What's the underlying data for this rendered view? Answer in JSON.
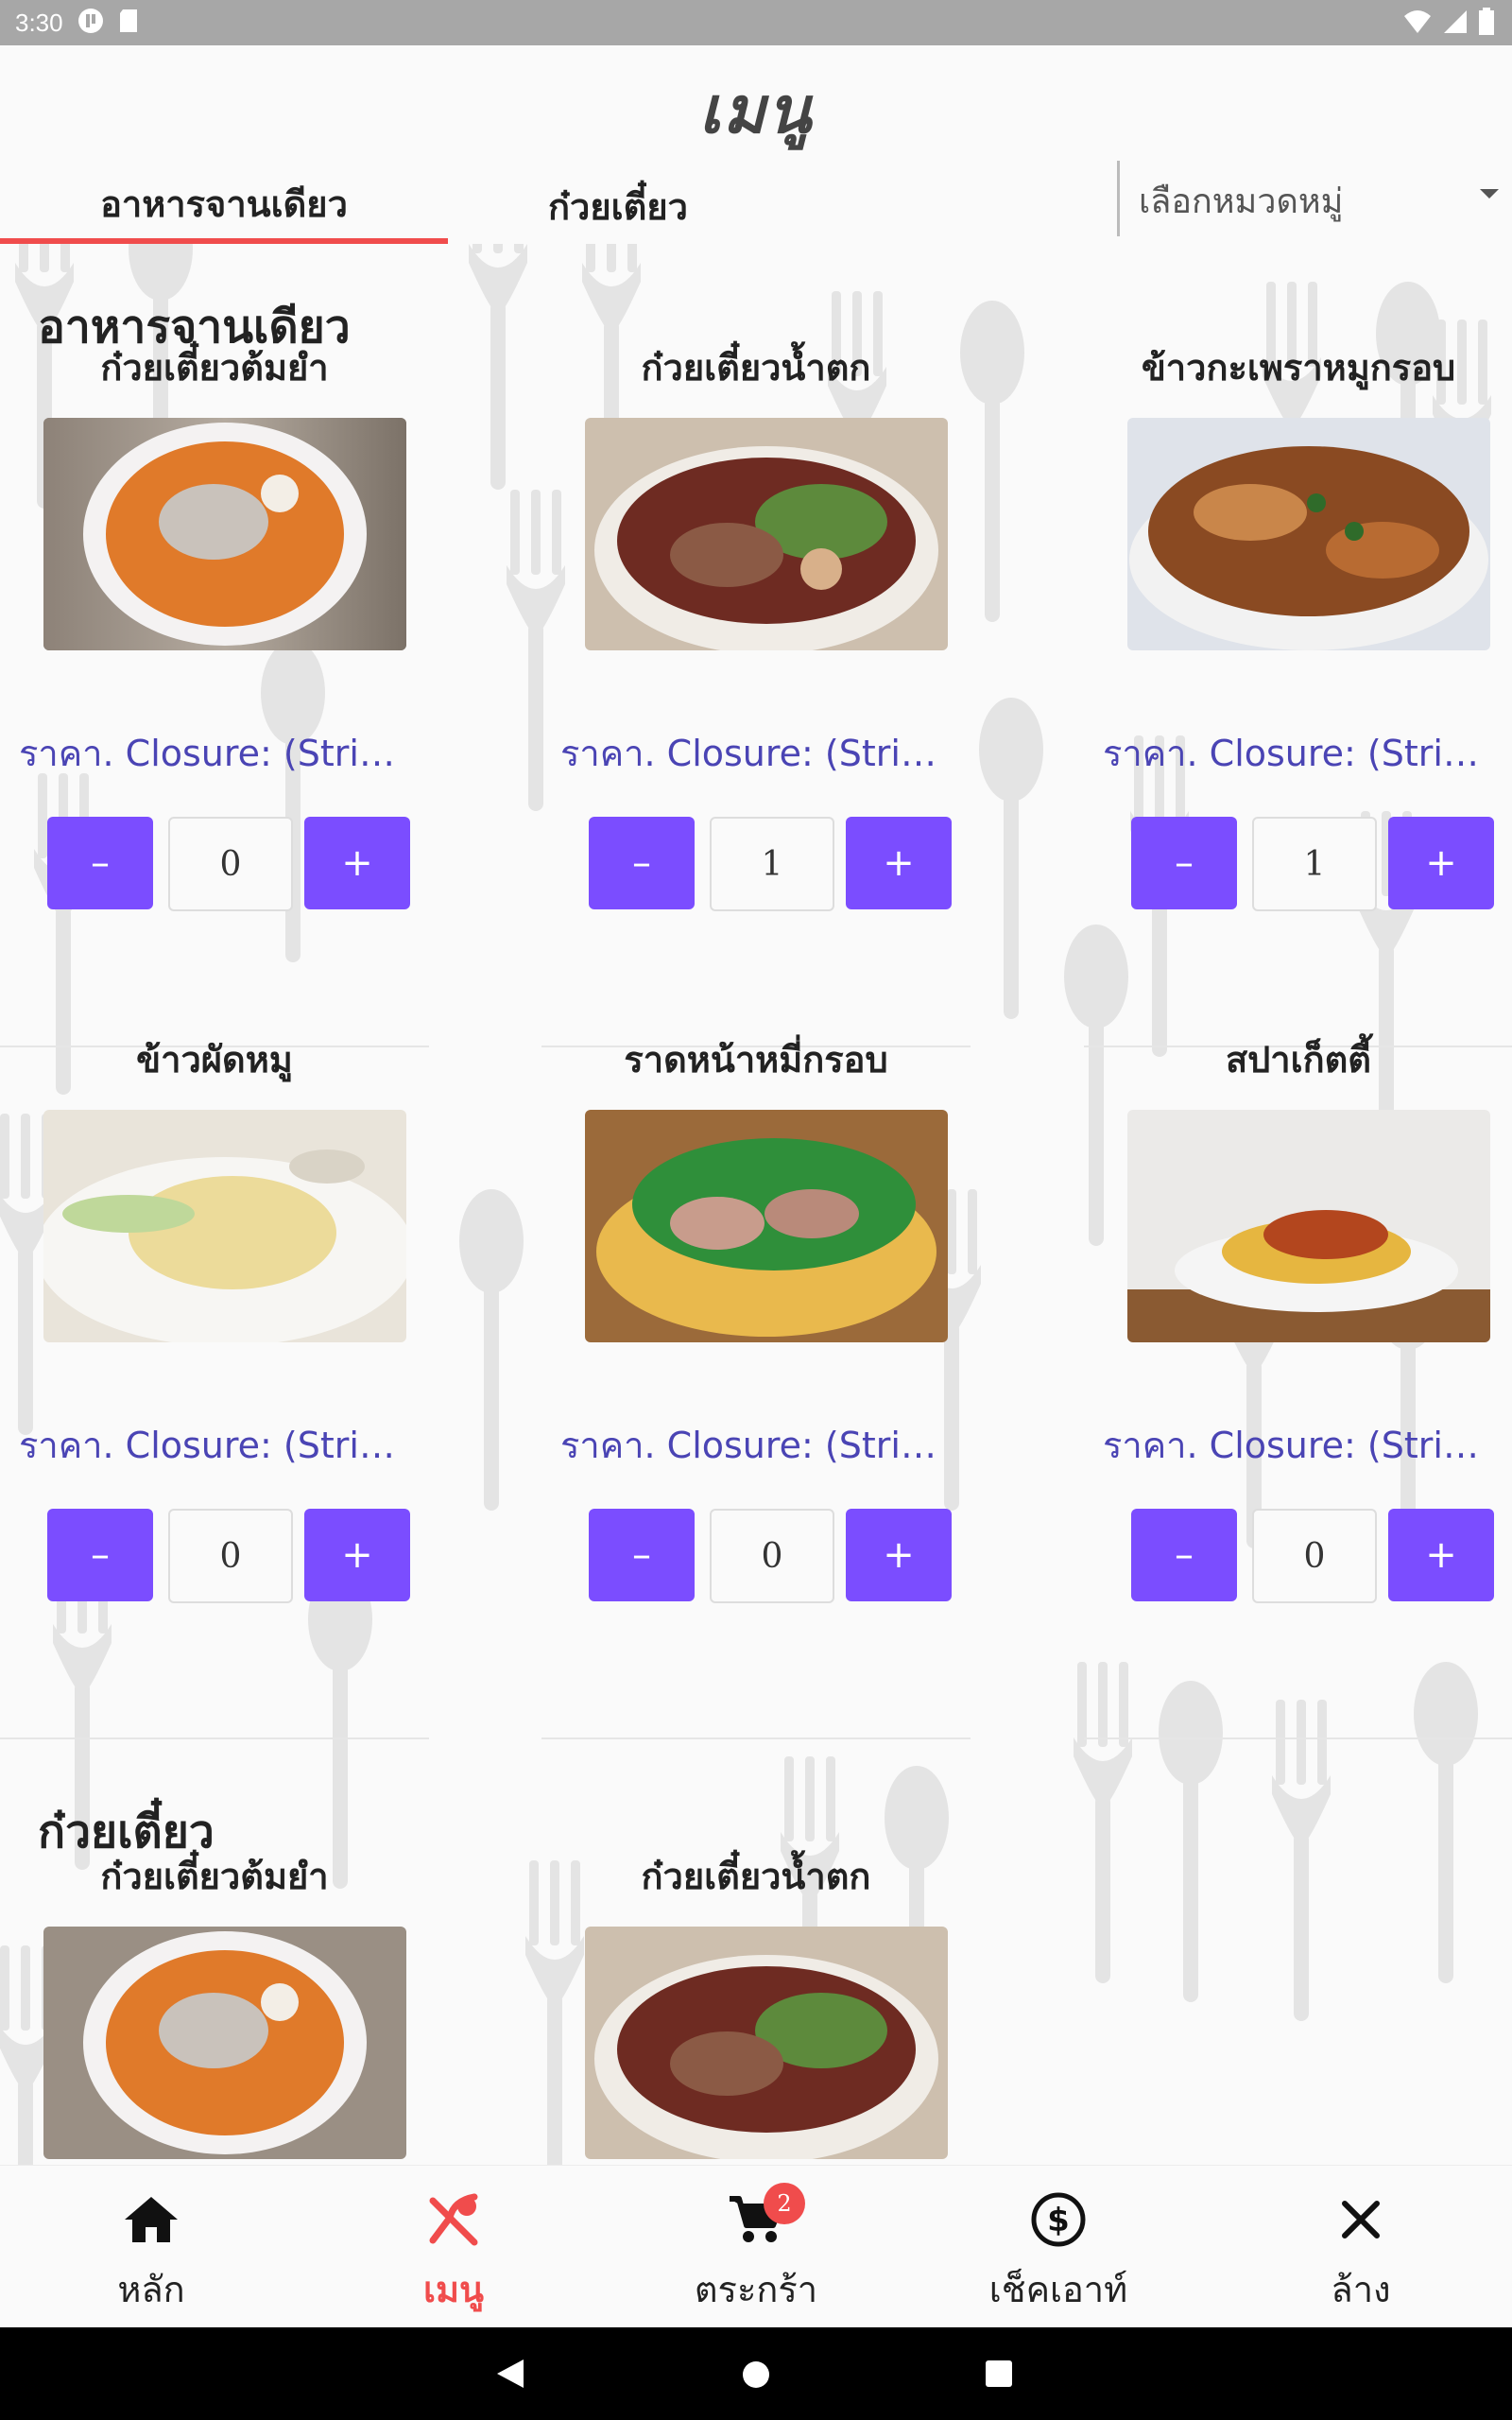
{
  "status_bar": {
    "time": "3:30"
  },
  "header": {
    "title": "เมนู",
    "tabs": [
      {
        "label": "อาหารจานเดียว",
        "active": true
      },
      {
        "label": "ก๋วยเตี๋ยว",
        "active": false
      }
    ],
    "category_select": {
      "placeholder": "เลือกหมวดหมู่"
    }
  },
  "sections": [
    {
      "title": "อาหารจานเดียว",
      "items": [
        {
          "name": "ก๋วยเตี๋ยวต้มยำ",
          "price": "ราคา. Closure: (String) => String",
          "qty": "0",
          "minus": "–",
          "plus": "+"
        },
        {
          "name": "ก๋วยเตี๋ยวน้ำตก",
          "price": "ราคา. Closure: (String) => String",
          "qty": "1",
          "minus": "–",
          "plus": "+"
        },
        {
          "name": "ข้าวกะเพราหมูกรอบ",
          "price": "ราคา. Closure: (String) => String",
          "qty": "1",
          "minus": "–",
          "plus": "+"
        },
        {
          "name": "ข้าวผัดหมู",
          "price": "ราคา. Closure: (String) => String",
          "qty": "0",
          "minus": "–",
          "plus": "+"
        },
        {
          "name": "ราดหน้าหมี่กรอบ",
          "price": "ราคา. Closure: (String) => String",
          "qty": "0",
          "minus": "–",
          "plus": "+"
        },
        {
          "name": "สปาเก็ตตี้",
          "price": "ราคา. Closure: (String) => String",
          "qty": "0",
          "minus": "–",
          "plus": "+"
        }
      ]
    },
    {
      "title": "ก๋วยเตี๋ยว",
      "items": [
        {
          "name": "ก๋วยเตี๋ยวต้มยำ"
        },
        {
          "name": "ก๋วยเตี๋ยวน้ำตก"
        }
      ]
    }
  ],
  "bottom_nav": [
    {
      "label": "หลัก",
      "icon": "home-icon",
      "active": false
    },
    {
      "label": "เมนู",
      "icon": "fork-knife-icon",
      "active": true
    },
    {
      "label": "ตระกร้า",
      "icon": "cart-icon",
      "badge": "2",
      "active": false
    },
    {
      "label": "เช็คเอาท์",
      "icon": "dollar-circle-icon",
      "active": false
    },
    {
      "label": "ล้าง",
      "icon": "close-icon",
      "active": false
    }
  ],
  "colors": {
    "accent_red": "#f04c4c",
    "button_purple": "#7b4dff",
    "price_blue": "#4a44b4",
    "status_bar": "#a7a7a7"
  }
}
